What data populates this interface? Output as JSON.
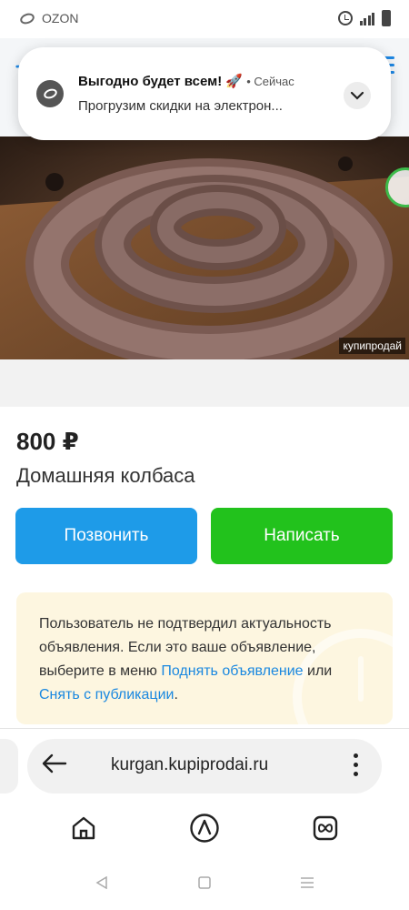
{
  "status_bar": {
    "app_name": "OZON",
    "icons": [
      "alarm-icon",
      "wifi-signal-icon",
      "battery-icon"
    ]
  },
  "notification": {
    "title": "Выгодно будет всем! 🚀",
    "time": "• Сейчас",
    "body": "Прогрузим скидки на электрон...",
    "icon": "ozon-icon"
  },
  "product": {
    "watermark": "купипродай",
    "price": "800 ₽",
    "title": "Домашняя колбаса"
  },
  "actions": {
    "call_label": "Позвонить",
    "write_label": "Написать",
    "call_color": "#1e9be8",
    "write_color": "#22c21c"
  },
  "notice": {
    "text_1": "Пользователь не подтвердил актуальность объявления. Если это ваше объявление, выберите в меню ",
    "link_raise": "Поднять объявление",
    "text_2": " или ",
    "link_unpublish": "Снять с публикации",
    "text_3": ".",
    "background": "#fdf6e0",
    "link_color": "#1a88e0"
  },
  "browser": {
    "url": "kurgan.kupiprodai.ru"
  }
}
